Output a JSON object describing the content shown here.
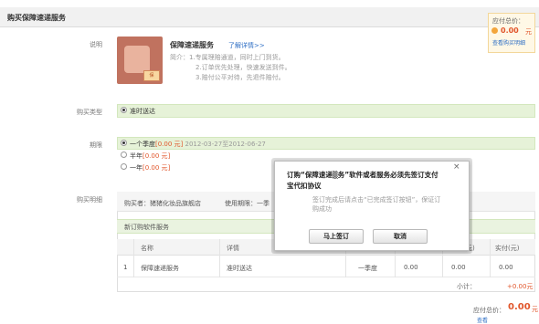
{
  "header": {
    "title": "购买保障速递服务"
  },
  "labels": {
    "description": "说明",
    "purchase_type": "购买类型",
    "period": "期限",
    "purchase_list": "购买明细"
  },
  "product": {
    "image_tag": "保",
    "name": "保障速递服务",
    "detail_link": "了解详情>>",
    "desc": [
      "简介：1.专属理赔通道，同时上门到货。",
      "2.订单优先处理，快速发送到件。",
      "3.赔付公平对待，先退件赔付。"
    ]
  },
  "total_box": {
    "label": "应付总价：",
    "value": "0.00",
    "unit": "元",
    "link": "查看购买明细"
  },
  "purchase_type": {
    "option": "准时送达"
  },
  "period": {
    "options": [
      {
        "label": "一个季度",
        "price": "[0.00 元]",
        "range": "2012-03-27至2012-06-27",
        "selected": true
      },
      {
        "label": "半年",
        "price": "[0.00 元]",
        "range": "",
        "selected": false
      },
      {
        "label": "一年",
        "price": "[0.00 元]",
        "range": "",
        "selected": false
      }
    ]
  },
  "purchase_list": {
    "buyer": "购买者：猪猪化妆品旗舰店",
    "usage": "使用期限：一季",
    "new_order_label": "新订购软件服务",
    "columns": [
      "名称",
      "详情",
      "元)",
      "实付(元)"
    ],
    "row": {
      "index": "1",
      "name": "保障速递服务",
      "detail": "准时送达",
      "period": "一季度",
      "price1": "0.00",
      "price2": "0.00",
      "price3": "0.00"
    },
    "subtotal_label": "小计：",
    "subtotal_value": "+0.00元"
  },
  "grand_total": {
    "label": "应付总价：",
    "value": "0.00",
    "unit": "元",
    "link": "查看"
  },
  "modal": {
    "close": "×",
    "title_line1": "订购“保障速递▒务”软件或者服务必须先签订支付",
    "title_line2": "宝代扣协议",
    "hint_line1": "签订完成后请点击“已完成签订按钮”，保证订",
    "hint_line2": "购成功",
    "sign_button": "马上签订",
    "cancel_button": "取消"
  },
  "colors": {
    "accent_red": "#e1562b",
    "link_blue": "#2f6fc5",
    "highlight_green": "#e6f2d8"
  }
}
